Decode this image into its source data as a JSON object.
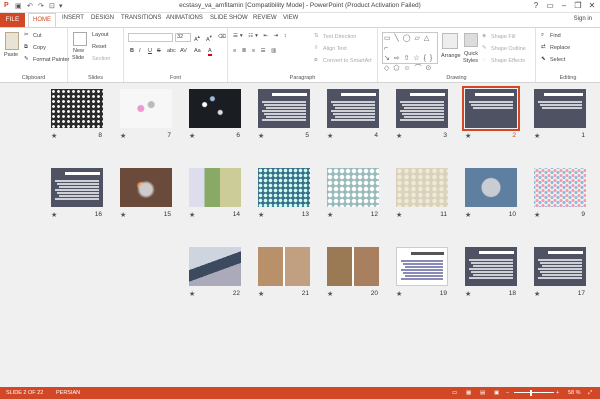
{
  "window": {
    "title": "ecstasy_va_amfitamin [Compatibility Mode] - PowerPoint (Product Activation Failed)",
    "sign_in": "Sign in",
    "help": "?"
  },
  "tabs": [
    "FILE",
    "HOME",
    "INSERT",
    "DESIGN",
    "TRANSITIONS",
    "ANIMATIONS",
    "SLIDE SHOW",
    "REVIEW",
    "VIEW"
  ],
  "ribbon": {
    "clipboard": {
      "label": "Clipboard",
      "paste": "Paste",
      "cut": "Cut",
      "copy": "Copy",
      "format_painter": "Format Painter"
    },
    "slides": {
      "label": "Slides",
      "new_slide": "New",
      "new_slide2": "Slide",
      "layout": "Layout",
      "reset": "Reset",
      "section": "Section"
    },
    "font": {
      "label": "Font",
      "size": "32",
      "bold": "B",
      "italic": "I",
      "underline": "U",
      "strike": "S",
      "shadow": "abc",
      "spacing": "AV",
      "case": "Aa",
      "color": "A"
    },
    "paragraph": {
      "label": "Paragraph",
      "text_direction": "Text Direction",
      "align_text": "Align Text",
      "convert_smartart": "Convert to SmartArt"
    },
    "drawing": {
      "label": "Drawing",
      "arrange": "Arrange",
      "quick_styles": "Quick",
      "quick_styles2": "Styles",
      "shape_fill": "Shape Fill",
      "shape_outline": "Shape Outline",
      "shape_effects": "Shape Effects"
    },
    "editing": {
      "label": "Editing",
      "find": "Find",
      "replace": "Replace",
      "select": "Select"
    }
  },
  "slides": [
    {
      "n": "1",
      "kind": "title"
    },
    {
      "n": "2",
      "kind": "title",
      "selected": true
    },
    {
      "n": "3",
      "kind": "text"
    },
    {
      "n": "4",
      "kind": "text"
    },
    {
      "n": "5",
      "kind": "text"
    },
    {
      "n": "6",
      "kind": "photo-pills-dark"
    },
    {
      "n": "7",
      "kind": "photo-pills-white"
    },
    {
      "n": "8",
      "kind": "photo-pills-grid"
    },
    {
      "n": "9",
      "kind": "photo-pills-colorgrid"
    },
    {
      "n": "10",
      "kind": "photo-pill-single"
    },
    {
      "n": "11",
      "kind": "photo-pills-cream"
    },
    {
      "n": "12",
      "kind": "photo-pills-bright"
    },
    {
      "n": "13",
      "kind": "photo-pills-blue"
    },
    {
      "n": "14",
      "kind": "photo-pills-green"
    },
    {
      "n": "15",
      "kind": "photo-hand"
    },
    {
      "n": "16",
      "kind": "text"
    },
    {
      "n": "17",
      "kind": "text"
    },
    {
      "n": "18",
      "kind": "text"
    },
    {
      "n": "19",
      "kind": "text-white"
    },
    {
      "n": "20",
      "kind": "photo-faces"
    },
    {
      "n": "21",
      "kind": "photo-faces2"
    },
    {
      "n": "22",
      "kind": "photo-laptop"
    }
  ],
  "status": {
    "slide": "SLIDE 2 OF 22",
    "language": "PERSIAN",
    "zoom": "58 %"
  },
  "colors": {
    "accent": "#d24726",
    "slide_bg": "#4f5262",
    "sorter_bg": "#f0f0f0"
  }
}
